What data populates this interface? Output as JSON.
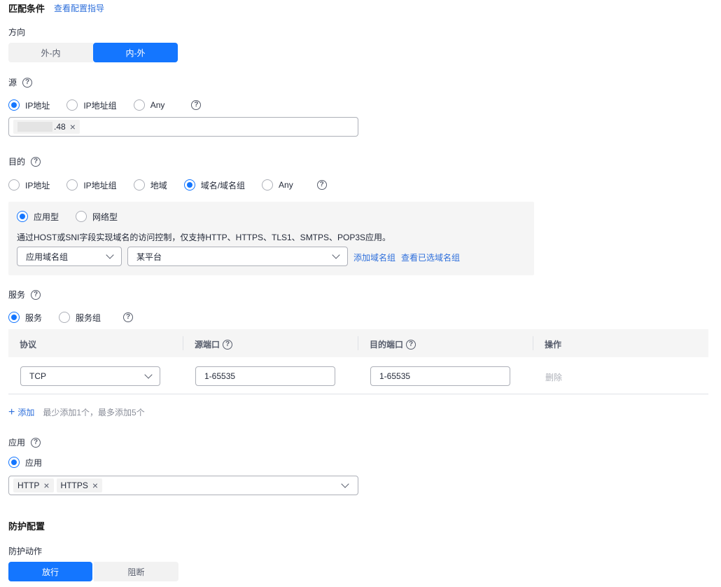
{
  "match": {
    "title": "匹配条件",
    "guide_link": "查看配置指导",
    "direction": {
      "label": "方向",
      "options": [
        "外-内",
        "内-外"
      ],
      "selected": "内-外"
    },
    "source": {
      "label": "源",
      "radios": [
        "IP地址",
        "IP地址组",
        "Any"
      ],
      "selected": "IP地址",
      "tag": ".48"
    },
    "destination": {
      "label": "目的",
      "radios": [
        "IP地址",
        "IP地址组",
        "地域",
        "域名/域名组",
        "Any"
      ],
      "selected": "域名/域名组",
      "panel": {
        "radios": [
          "应用型",
          "网络型"
        ],
        "selected": "应用型",
        "desc": "通过HOST或SNI字段实现域名的访问控制，仅支持HTTP、HTTPS、TLS1、SMTPS、POP3S应用。",
        "select1": "应用域名组",
        "select2": "某平台",
        "add_link": "添加域名组",
        "view_link": "查看已选域名组"
      }
    },
    "service": {
      "label": "服务",
      "radios": [
        "服务",
        "服务组"
      ],
      "selected": "服务",
      "table": {
        "headers": [
          "协议",
          "源端口",
          "目的端口",
          "操作"
        ],
        "row": {
          "protocol": "TCP",
          "src_port": "1-65535",
          "dst_port": "1-65535",
          "action": "删除"
        }
      },
      "add_label": "添加",
      "add_hint": "最少添加1个，最多添加5个"
    },
    "application": {
      "label": "应用",
      "radio": "应用",
      "tags": [
        "HTTP",
        "HTTPS"
      ]
    }
  },
  "protection": {
    "title": "防护配置",
    "action_label": "防护动作",
    "options": [
      "放行",
      "阻断"
    ],
    "selected": "放行"
  },
  "colors": {
    "primary": "#1476ff",
    "link": "#2e6fdb"
  }
}
